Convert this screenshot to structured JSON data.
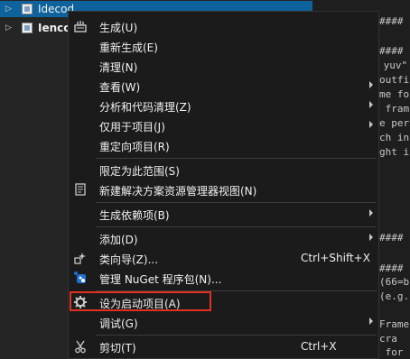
{
  "tree": {
    "items": [
      {
        "label": "Idecod",
        "selected": true
      },
      {
        "label": "Ienco",
        "selected": false
      }
    ]
  },
  "editor": {
    "lines": [
      "####",
      "####",
      " yuv\"",
      "outfi",
      "me fo",
      " fram",
      "e per",
      "ch in",
      "ght i",
      "####",
      "####",
      "(66=b",
      "(e.g.",
      "Frame",
      "cra",
      " for"
    ]
  },
  "menu": {
    "items": [
      {
        "icon": "build-icon",
        "label": "生成(U)",
        "shortcut": "",
        "submenu": false
      },
      {
        "icon": "",
        "label": "重新生成(E)",
        "shortcut": "",
        "submenu": false
      },
      {
        "icon": "",
        "label": "清理(N)",
        "shortcut": "",
        "submenu": false
      },
      {
        "icon": "",
        "label": "查看(W)",
        "shortcut": "",
        "submenu": true
      },
      {
        "icon": "",
        "label": "分析和代码清理(Z)",
        "shortcut": "",
        "submenu": true
      },
      {
        "icon": "",
        "label": "仅用于项目(J)",
        "shortcut": "",
        "submenu": true
      },
      {
        "icon": "",
        "label": "重定向项目(R)",
        "shortcut": "",
        "submenu": false
      },
      {
        "icon": "",
        "label": "限定为此范围(S)",
        "shortcut": "",
        "submenu": false
      },
      {
        "icon": "new-view-icon",
        "label": "新建解决方案资源管理器视图(N)",
        "shortcut": "",
        "submenu": false
      },
      {
        "icon": "",
        "label": "生成依赖项(B)",
        "shortcut": "",
        "submenu": true
      },
      {
        "icon": "",
        "label": "添加(D)",
        "shortcut": "",
        "submenu": true
      },
      {
        "icon": "class-wizard-icon",
        "label": "类向导(Z)...",
        "shortcut": "Ctrl+Shift+X",
        "submenu": false
      },
      {
        "icon": "nuget-icon",
        "label": "管理 NuGet 程序包(N)...",
        "shortcut": "",
        "submenu": false
      },
      {
        "icon": "gear-icon",
        "label": "设为启动项目(A)",
        "shortcut": "",
        "submenu": false
      },
      {
        "icon": "",
        "label": "调试(G)",
        "shortcut": "",
        "submenu": true
      },
      {
        "icon": "scissors-icon",
        "label": "剪切(T)",
        "shortcut": "Ctrl+X",
        "submenu": false
      }
    ]
  }
}
